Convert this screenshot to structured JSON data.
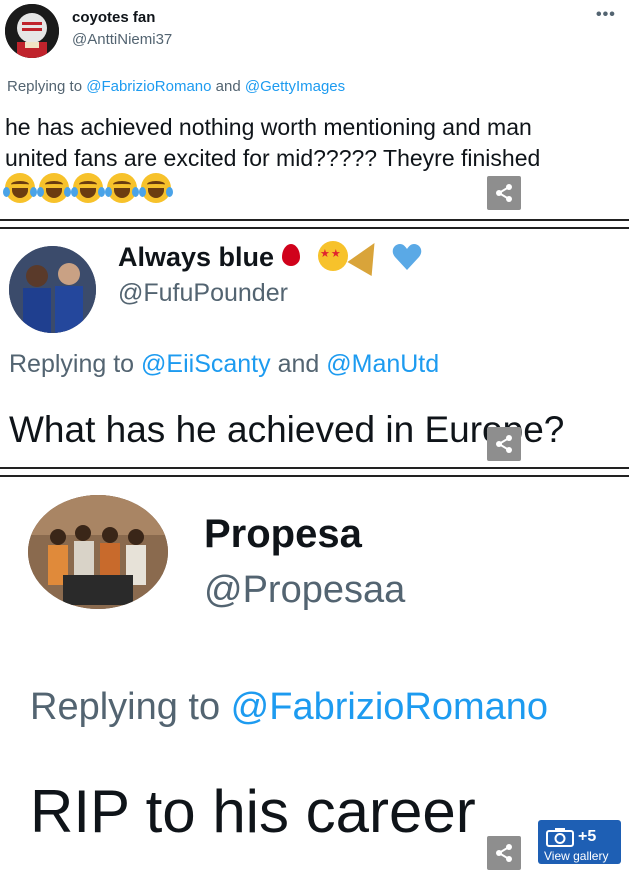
{
  "tweets": [
    {
      "name": "coyotes fan",
      "handle": "@AnttiNiemi37",
      "replying_prefix": "Replying to ",
      "mention_1": "@FabrizioRomano",
      "joiner": " and ",
      "mention_2": "@GettyImages",
      "body_line_1": "he has achieved nothing worth mentioning and man",
      "body_line_2": "united fans are excited for mid????? Theyre finished",
      "emoji": "face-with-tears-of-joy",
      "emoji_count": 5,
      "more_label": "•••"
    },
    {
      "name": "Always blue",
      "handle": "@FufuPounder",
      "name_emojis": [
        "drop-of-blood",
        "star-struck",
        "party-popper",
        "blue-heart"
      ],
      "replying_prefix": "Replying to ",
      "mention_1": "@EiiScanty",
      "joiner": " and ",
      "mention_2": "@ManUtd",
      "body_line_1": "What has he achieved in Europe?"
    },
    {
      "name": "Propesa",
      "handle": "@Propesaa",
      "replying_prefix": "Replying to ",
      "mention_1": "@FabrizioRomano",
      "body_line_1": "RIP to his career"
    }
  ],
  "share_icon": "share-icon",
  "gallery": {
    "count": "+5",
    "label": "View gallery",
    "icon": "camera-icon",
    "color": "#1e5fb4"
  },
  "colors": {
    "mention": "#1d9bf0",
    "secondary_text": "#536471",
    "share_bg": "#8e8e8e"
  }
}
